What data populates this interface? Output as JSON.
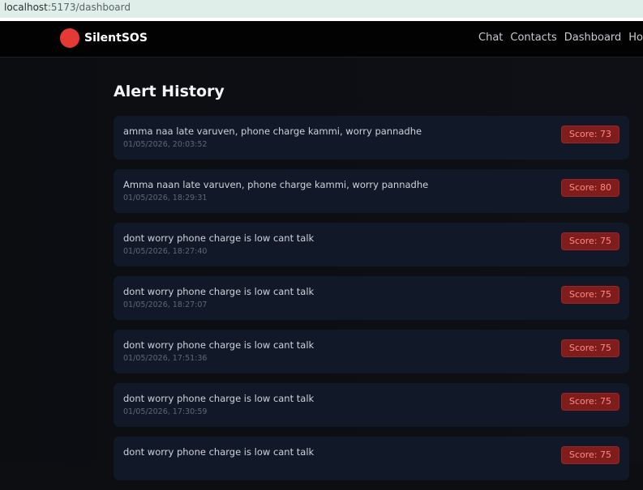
{
  "browser": {
    "url_host": "localhost",
    "url_path": ":5173/dashboard"
  },
  "navbar": {
    "brand": "SilentSOS",
    "links": [
      "Chat",
      "Contacts",
      "Dashboard",
      "How"
    ],
    "brand_color": "#e53935"
  },
  "page": {
    "title": "Alert History"
  },
  "alerts": [
    {
      "message": "amma naa late varuven, phone charge kammi, worry pannadhe",
      "timestamp": "01/05/2026, 20:03:52",
      "score": "Score: 73"
    },
    {
      "message": "Amma naan late varuven, phone charge kammi, worry pannadhe",
      "timestamp": "01/05/2026, 18:29:31",
      "score": "Score: 80"
    },
    {
      "message": "dont worry phone charge is low cant talk",
      "timestamp": "01/05/2026, 18:27:40",
      "score": "Score: 75"
    },
    {
      "message": "dont worry phone charge is low cant talk",
      "timestamp": "01/05/2026, 18:27:07",
      "score": "Score: 75"
    },
    {
      "message": "dont worry phone charge is low cant talk",
      "timestamp": "01/05/2026, 17:51:36",
      "score": "Score: 75"
    },
    {
      "message": "dont worry phone charge is low cant talk",
      "timestamp": "01/05/2026, 17:30:59",
      "score": "Score: 75"
    },
    {
      "message": "dont worry phone charge is low cant talk",
      "timestamp": "",
      "score": "Score: 75"
    }
  ],
  "colors": {
    "score_badge_bg": "#7f1d1d",
    "score_badge_text": "#ff8a80",
    "card_bg": "#111827"
  }
}
